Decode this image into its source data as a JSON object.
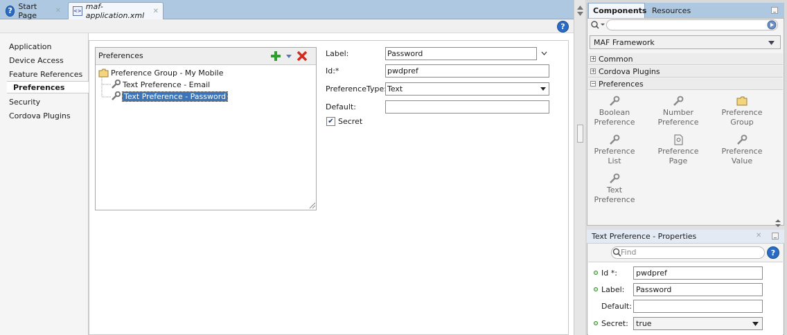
{
  "editor_tabs": [
    {
      "label": "Start Page"
    },
    {
      "label": "maf-application.xml"
    }
  ],
  "left_nav": [
    "Application",
    "Device Access",
    "Feature References",
    "Preferences",
    "Security",
    "Cordova Plugins"
  ],
  "preferences_panel": {
    "title": "Preferences",
    "tree": [
      {
        "label": "Preference Group - My Mobile"
      },
      {
        "label": "Text Preference - Email"
      },
      {
        "label": "Text Preference - Password"
      }
    ]
  },
  "form": {
    "label_label": "Label:",
    "label_value": "Password",
    "id_label": "Id:*",
    "id_value": "pwdpref",
    "type_label": "PreferenceType:",
    "type_value": "Text",
    "default_label": "Default:",
    "default_value": "",
    "secret_label": "Secret",
    "secret_checked": true
  },
  "right_tabs": [
    "Components",
    "Resources"
  ],
  "palette": {
    "framework": "MAF Framework",
    "sections": [
      "Common",
      "Cordova Plugins",
      "Preferences"
    ],
    "items": [
      {
        "line1": "Boolean",
        "line2": "Preference",
        "icon": "wrench-icon"
      },
      {
        "line1": "Number",
        "line2": "Preference",
        "icon": "wrench-icon"
      },
      {
        "line1": "Preference",
        "line2": "Group",
        "icon": "folder-icon"
      },
      {
        "line1": "Preference",
        "line2": "List",
        "icon": "wrench-icon"
      },
      {
        "line1": "Preference",
        "line2": "Page",
        "icon": "page-icon"
      },
      {
        "line1": "Preference",
        "line2": "Value",
        "icon": "wrench-icon"
      },
      {
        "line1": "Text",
        "line2": "Preference",
        "icon": "wrench-icon"
      }
    ]
  },
  "properties": {
    "title": "Text Preference - Properties",
    "search_placeholder": "Find",
    "rows": [
      {
        "label": "Id *:",
        "value": "pwdpref"
      },
      {
        "label": "Label:",
        "value": "Password"
      },
      {
        "label": "Default:",
        "value": ""
      },
      {
        "label": "Secret:",
        "value": "true"
      }
    ]
  },
  "colors": {
    "selection": "#3b74b8",
    "tab_bar": "#aec8e2",
    "add_green": "#2e9e2e",
    "delete_red": "#d42b1e"
  }
}
